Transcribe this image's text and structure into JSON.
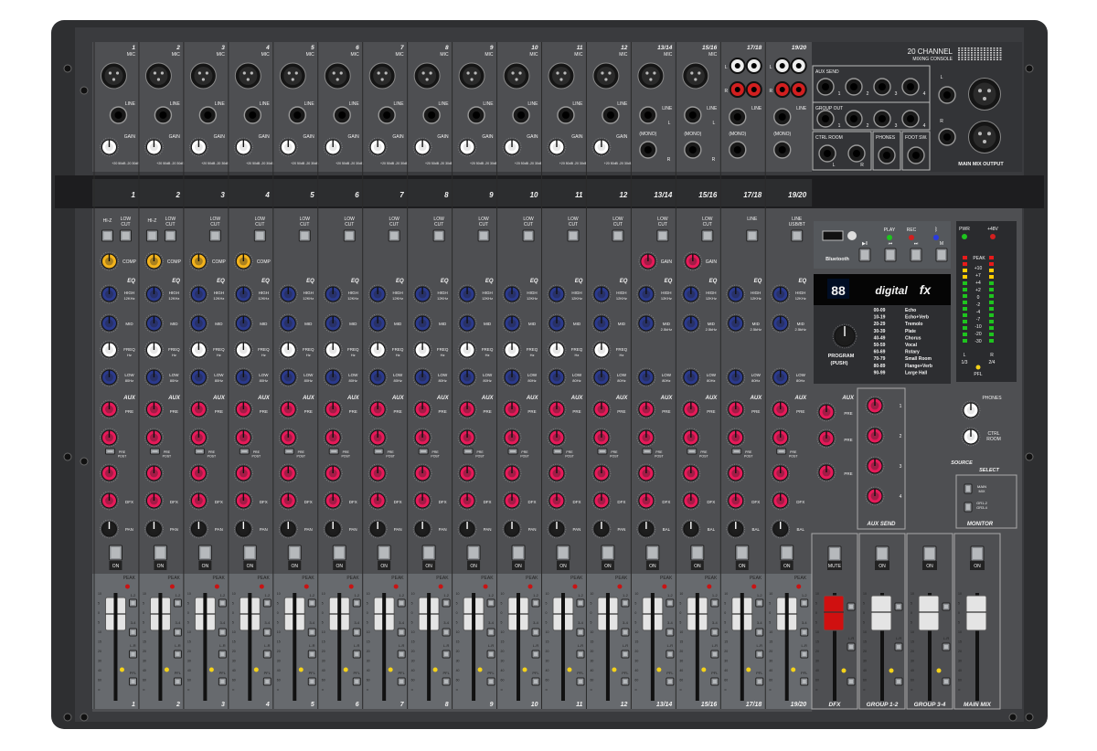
{
  "brand": {
    "title": "20 CHANNEL",
    "subtitle": "MIXING CONSOLE"
  },
  "channels": [
    {
      "number": "1",
      "input": "mic",
      "hiz": true,
      "lowcut": true,
      "comp": true,
      "eq": "4"
    },
    {
      "number": "2",
      "input": "mic",
      "hiz": true,
      "lowcut": true,
      "comp": true,
      "eq": "4"
    },
    {
      "number": "3",
      "input": "mic",
      "hiz": false,
      "lowcut": true,
      "comp": true,
      "eq": "4"
    },
    {
      "number": "4",
      "input": "mic",
      "hiz": false,
      "lowcut": true,
      "comp": true,
      "eq": "4"
    },
    {
      "number": "5",
      "input": "mic",
      "hiz": false,
      "lowcut": true,
      "comp": false,
      "eq": "4"
    },
    {
      "number": "6",
      "input": "mic",
      "hiz": false,
      "lowcut": true,
      "comp": false,
      "eq": "4"
    },
    {
      "number": "7",
      "input": "mic",
      "hiz": false,
      "lowcut": true,
      "comp": false,
      "eq": "4"
    },
    {
      "number": "8",
      "input": "mic",
      "hiz": false,
      "lowcut": true,
      "comp": false,
      "eq": "4"
    },
    {
      "number": "9",
      "input": "mic",
      "hiz": false,
      "lowcut": true,
      "comp": false,
      "eq": "4"
    },
    {
      "number": "10",
      "input": "mic",
      "hiz": false,
      "lowcut": true,
      "comp": false,
      "eq": "4"
    },
    {
      "number": "11",
      "input": "mic",
      "hiz": false,
      "lowcut": true,
      "comp": false,
      "eq": "4"
    },
    {
      "number": "12",
      "input": "mic",
      "hiz": false,
      "lowcut": true,
      "comp": false,
      "eq": "4"
    },
    {
      "number": "13/14",
      "input": "stereo_mic",
      "hiz": false,
      "lowcut": true,
      "comp": false,
      "eq": "3"
    },
    {
      "number": "15/16",
      "input": "stereo_mic",
      "hiz": false,
      "lowcut": true,
      "comp": false,
      "eq": "3"
    },
    {
      "number": "17/18",
      "input": "rca",
      "hiz": false,
      "lowcut": false,
      "comp": false,
      "eq": "3",
      "line_switch": "LINE"
    },
    {
      "number": "19/20",
      "input": "rca",
      "hiz": false,
      "lowcut": false,
      "comp": false,
      "eq": "3",
      "line_switch": "LINE\nUSB/BT"
    }
  ],
  "labels": {
    "mic": "MIC",
    "line": "LINE",
    "gain": "GAIN",
    "mono": "(MONO)",
    "hiz": "HI-Z",
    "lowcut": "LOW\nCUT",
    "comp": "COMP",
    "eq": "EQ",
    "high": "HIGH",
    "high_freq": "12KHz",
    "mid": "MID",
    "mid_freq": "2.5kHz",
    "freq": "FREQ",
    "freq_unit": "Hz",
    "low": "LOW",
    "low_freq": "80Hz",
    "aux": "AUX",
    "pre": "PRE",
    "dfx": "DFX",
    "pan": "PAN",
    "bal": "BAL",
    "on": "ON",
    "mute": "MUTE",
    "peak": "PEAK",
    "bus12": "1-2",
    "bus34": "3-4",
    "buslr": "L-R",
    "pfl": "PFL",
    "prepost": "PRE\nPOST",
    "gain_range": "+20 50dB -20 30dB",
    "fader_scale": [
      "10",
      "5",
      "0",
      "5",
      "10",
      "15",
      "20",
      "30",
      "40",
      "60",
      "∞"
    ]
  },
  "io": {
    "aux_send": "AUX SEND",
    "group_out": "GROUP OUT",
    "ctrl_room": "CTRL ROOM",
    "phones": "PHONES",
    "foot_sw": "FOOT SW.",
    "main_mix_output": "MAIN MIX OUTPUT",
    "l": "L",
    "r": "R",
    "jacks": [
      "1",
      "2",
      "3",
      "4"
    ]
  },
  "usb": {
    "bluetooth": "Bluetooth",
    "play": "PLAY",
    "rec": "REC",
    "buttons": [
      "▶‖",
      "⏮",
      "⏭",
      "M"
    ]
  },
  "dfx": {
    "brand": "digital",
    "brand_fx": "fx",
    "display": "88",
    "program": "PROGRAM",
    "push": "(PUSH)",
    "presets": [
      {
        "range": "00-09",
        "name": "Echo"
      },
      {
        "range": "10-19",
        "name": "Echo+Verb"
      },
      {
        "range": "20-29",
        "name": "Tremolo"
      },
      {
        "range": "30-39",
        "name": "Plate"
      },
      {
        "range": "40-49",
        "name": "Chorus"
      },
      {
        "range": "50-59",
        "name": "Vocal"
      },
      {
        "range": "60-69",
        "name": "Rotary"
      },
      {
        "range": "70-79",
        "name": "Small Room"
      },
      {
        "range": "80-89",
        "name": "Flange+Verb"
      },
      {
        "range": "90-99",
        "name": "Large Hall"
      }
    ]
  },
  "meter": {
    "pwr": "PWR",
    "phantom": "+48V",
    "peak": "PEAK",
    "scale": [
      "+10",
      "+7",
      "+4",
      "+2",
      "0",
      "-2",
      "-4",
      "-7",
      "-10",
      "-20",
      "-30"
    ],
    "l": "L",
    "r": "R",
    "ch13": "1/3",
    "ch24": "2/4",
    "pfl": "PFL"
  },
  "monitor": {
    "phones": "PHONES",
    "ctrl_room": "CTRL\nROOM",
    "source": "SOURCE",
    "select": "SELECT",
    "main": "MAIN\nMIX",
    "grp": "GR1-2\nGR3-4",
    "title": "MONITOR"
  },
  "aux_master": {
    "title": "AUX SEND",
    "numbers": [
      "1",
      "2",
      "3",
      "4"
    ]
  },
  "sections": {
    "dfx": "DFX",
    "group12": "GROUP 1-2",
    "group34": "GROUP 3-4",
    "main": "MAIN MIX"
  },
  "colors": {
    "panel": "#4e4f52",
    "case": "#2e2f31",
    "comp_knob": "#f2b21c",
    "gain_knob": "#ffffff",
    "eq_knob": "#2b3a8c",
    "aux_knob": "#e61a59",
    "pan_knob": "#1c1c1c",
    "freq_knob": "#ffffff",
    "dfx_fader": "#d01010"
  }
}
